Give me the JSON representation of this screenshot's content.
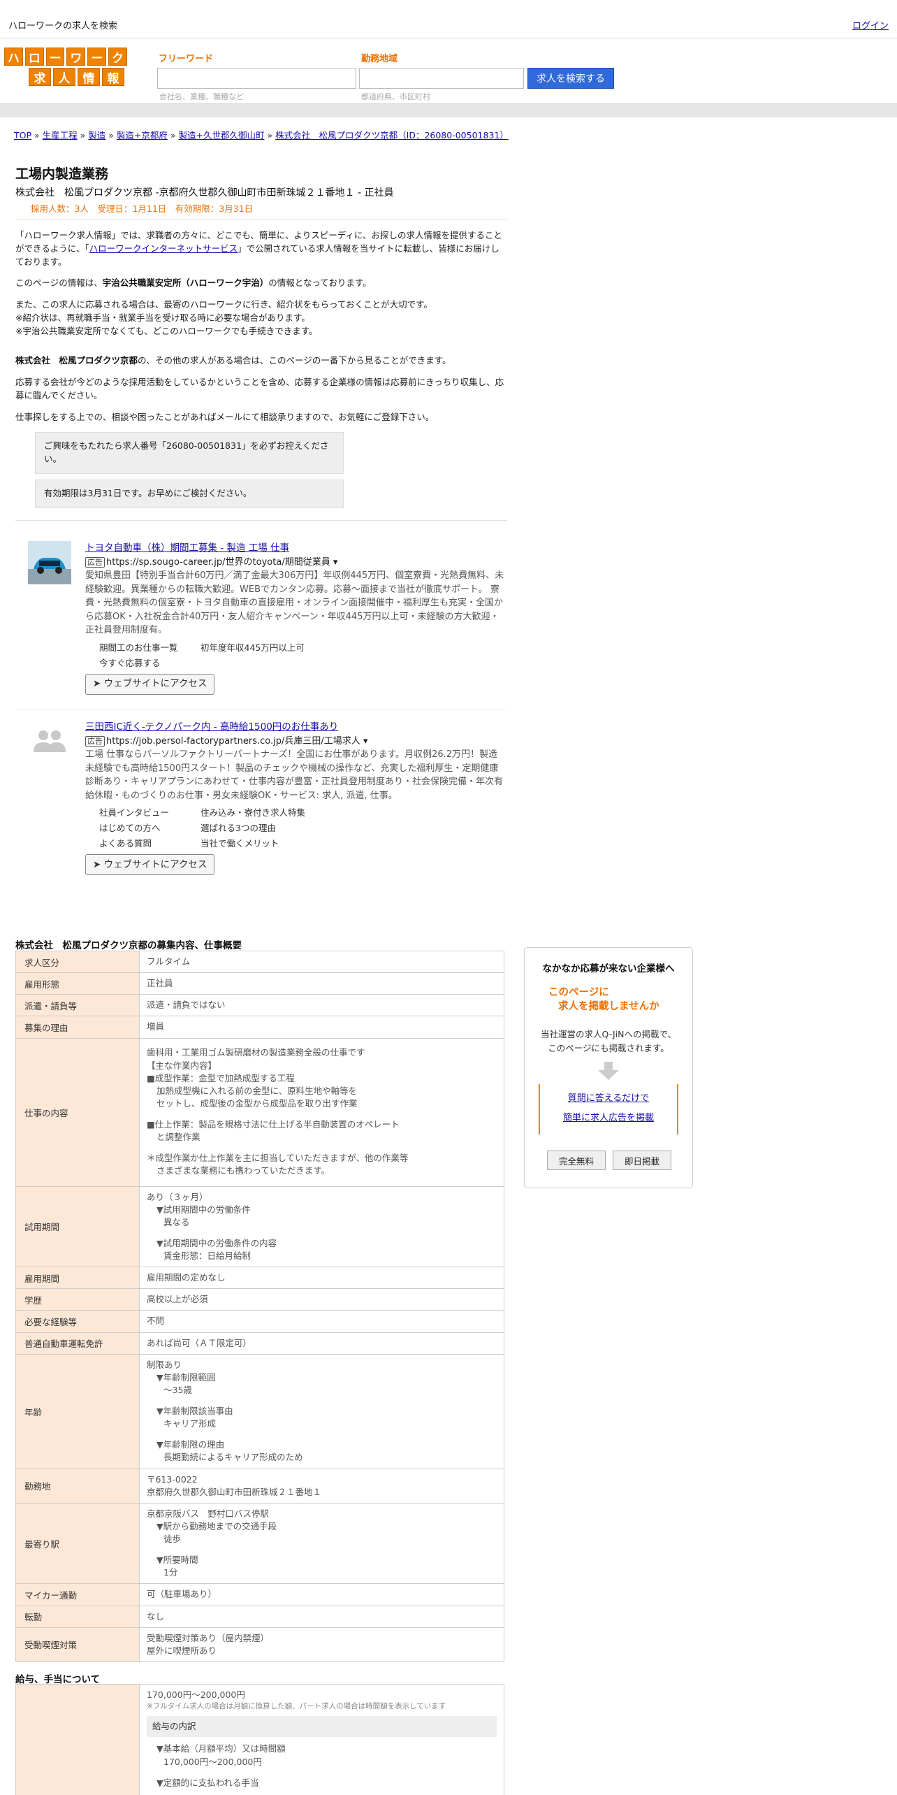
{
  "topbar": {
    "title": "ハローワークの求人を検索",
    "login": "ログイン"
  },
  "logo": {
    "row1": [
      "ハ",
      "ロ",
      "ー",
      "ワ",
      "ー",
      "ク"
    ],
    "row2": [
      "求",
      "人",
      "情",
      "報"
    ]
  },
  "search": {
    "keyword_label": "フリーワード",
    "keyword_hint": "会社名、業種、職種など",
    "area_label": "勤務地域",
    "area_hint": "都道府県、市区町村",
    "button": "求人を検索する"
  },
  "breadcrumb": {
    "items": [
      "TOP",
      "生産工程",
      "製造",
      "製造+京都府",
      "製造+久世郡久御山町",
      "株式会社　松風プロダクツ京都（ID：26080-00501831）"
    ],
    "sep": "»"
  },
  "job": {
    "title": "工場内製造業務",
    "company_line": "株式会社　松風プロダクツ京都 -京都府久世郡久御山町市田新珠城２１番地１ - 正社員",
    "meta": "採用人数：3人　受理日：1月11日　有効期限：3月31日"
  },
  "intro": {
    "p1_a": "「ハローワーク求人情報」では、求職者の方々に、どこでも、簡単に、よりスピーディに、お探しの求人情報を提供することができるように、「",
    "p1_link": "ハローワークインターネットサービス",
    "p1_b": "」で公開されている求人情報を当サイトに転載し、皆様にお届けしております。",
    "p2_a": "このページの情報は、",
    "p2_b": "宇治公共職業安定所（ハローワーク宇治）",
    "p2_c": "の情報となっております。",
    "p3_1": "また、この求人に応募される場合は、最寄のハローワークに行き、紹介状をもらっておくことが大切です。",
    "p3_2": "※紹介状は、再就職手当・就業手当を受け取る時に必要な場合があります。",
    "p3_3": "※宇治公共職業安定所でなくても、どこのハローワークでも手続きできます。",
    "p4_a": "株式会社　松風プロダクツ京都",
    "p4_b": "の、その他の求人がある場合は、このページの一番下から見ることができます。",
    "p5": "応募する会社が今どのような採用活動をしているかということを含め、応募する企業様の情報は応募前にきっちり収集し、応募に臨んでください。",
    "p6": "仕事探しをする上での、相談や困ったことがあればメールにて相談承りますので、お気軽にご登録下さい。"
  },
  "notices": {
    "n1": "ご興味をもたれたら求人番号「26080-00501831」を必ずお控えください。",
    "n2": "有効期限は3月31日です。お早めにご検討ください。"
  },
  "ads": [
    {
      "title": "トヨタ自動車（株）期間工募集 - 製造 工場 仕事",
      "badge": "広告",
      "url": "https://sp.sougo-career.jp/世界のtoyota/期間従業員 ▾",
      "desc": "愛知県豊田【特別手当合計60万円／満了金最大306万円】年収例445万円、個室寮費・光熱費無料、未経験歓迎。異業種からの転職大歓迎。WEBでカンタン応募。応募～面接まで当社が徹底サポート。 寮費・光熱費無料の個室寮・トヨタ自動車の直接雇用・オンライン面接開催中・福利厚生も充実・全国から応募OK・入社祝金合計40万円・友人紹介キャンペーン・年収445万円以上可・未経験の方大歓迎・正社員登用制度有。",
      "links": [
        "期間工のお仕事一覧",
        "初年度年収445万円以上可",
        "今すぐ応募する",
        ""
      ],
      "button": "➤ ウェブサイトにアクセス"
    },
    {
      "title": "三田西IC近く-テクノパーク内 - 高時給1500円のお仕事あり",
      "badge": "広告",
      "url": "https://job.persol-factorypartners.co.jp/兵庫三田/工場求人 ▾",
      "desc": "工場 仕事ならパーソルファクトリーパートナーズ！全国にお仕事があります。月収例26.2万円！製造未経験でも高時給1500円スタート！製品のチェックや機械の操作など、充実した福利厚生・定期健康診断あり・キャリアプランにあわせて・仕事内容が豊富・正社員登用制度あり・社会保険完備・年次有給休暇・ものづくりのお仕事・男女未経験OK・サービス: 求人, 派遣, 仕事。",
      "links": [
        "社員インタビュー",
        "住み込み・寮付き求人特集",
        "はじめての方へ",
        "選ばれる3つの理由",
        "よくある質問",
        "当社で働くメリット"
      ],
      "button": "➤ ウェブサイトにアクセス"
    }
  ],
  "section1_title": "株式会社　松風プロダクツ京都の募集内容、仕事概要",
  "table": {
    "kyujin_kubun": {
      "k": "求人区分",
      "v": "フルタイム"
    },
    "koyo_keitai": {
      "k": "雇用形態",
      "v": "正社員"
    },
    "haken": {
      "k": "派遣・請負等",
      "v": "派遣・請負ではない"
    },
    "riyu": {
      "k": "募集の理由",
      "v": "増員"
    },
    "shigoto": {
      "k": "仕事の内容",
      "l1": "歯科用・工業用ゴム製研磨材の製造業務全般の仕事です",
      "l2": "【主な作業内容】",
      "l3": "■成型作業：金型で加熱成型する工程",
      "l4": "加熱成型機に入れる前の金型に、原料生地や軸等を",
      "l5": "セットし、成型後の金型から成型品を取り出す作業",
      "l6": "■仕上作業：製品を規格寸法に仕上げる半自動装置のオペレート",
      "l7": "と調整作業",
      "l8": "＊成型作業か仕上作業を主に担当していただきますが、他の作業等",
      "l9": "さまざまな業務にも携わっていただきます。"
    },
    "shiyo": {
      "k": "試用期間",
      "l1": "あり（３ヶ月）",
      "l2": "▼試用期間中の労働条件",
      "l3": "異なる",
      "l4": "▼試用期間中の労働条件の内容",
      "l5": "賃金形態：日給月給制"
    },
    "koyo_kikan": {
      "k": "雇用期間",
      "v": "雇用期間の定めなし"
    },
    "gakureki": {
      "k": "学歴",
      "v": "高校以上が必須"
    },
    "keiken": {
      "k": "必要な経験等",
      "v": "不問"
    },
    "menkyo": {
      "k": "普通自動車運転免許",
      "v": "あれば尚可（ＡＴ限定可）"
    },
    "nenrei": {
      "k": "年齢",
      "l1": "制限あり",
      "l2": "▼年齢制限範囲",
      "l3": "～35歳",
      "l4": "▼年齢制限該当事由",
      "l5": "キャリア形成",
      "l6": "▼年齢制限の理由",
      "l7": "長期勤続によるキャリア形成のため"
    },
    "kinmuchi": {
      "k": "勤務地",
      "l1": "〒613-0022",
      "l2": "京都府久世郡久御山町市田新珠城２１番地１"
    },
    "moyori": {
      "k": "最寄り駅",
      "l1": "京都京阪バス　野村口バス停駅",
      "l2": "▼駅から勤務地までの交通手段",
      "l3": "徒歩",
      "l4": "▼所要時間",
      "l5": "1分"
    },
    "mycar": {
      "k": "マイカー通勤",
      "v": "可（駐車場あり）"
    },
    "tenkin": {
      "k": "転勤",
      "v": "なし"
    },
    "judo": {
      "k": "受動喫煙対策",
      "l1": "受動喫煙対策あり（屋内禁煙）",
      "l2": "屋外に喫煙所あり"
    }
  },
  "section2_title": "給与、手当について",
  "salary": {
    "range": "170,000円〜200,000円",
    "note": "※フルタイム求人の場合は月額に換算した額、パート求人の場合は時間額を表示しています",
    "breakdown_title": "給与の内訳",
    "l1": "▼基本給（月額平均）又は時間額",
    "l2": "170,000円〜200,000円",
    "l3": "▼定額的に支払われる手当"
  },
  "promo": {
    "heading": "なかなか応募が来ない企業様へ",
    "orange1": "このページに",
    "orange2": "求人を掲載しませんか",
    "desc1": "当社運営の求人Q-JiNへの掲載で、",
    "desc2": "このページにも掲載されます。",
    "link1": "質問に答えるだけで",
    "link2": "簡単に求人広告を掲載",
    "btn1": "完全無料",
    "btn2": "即日掲載"
  }
}
